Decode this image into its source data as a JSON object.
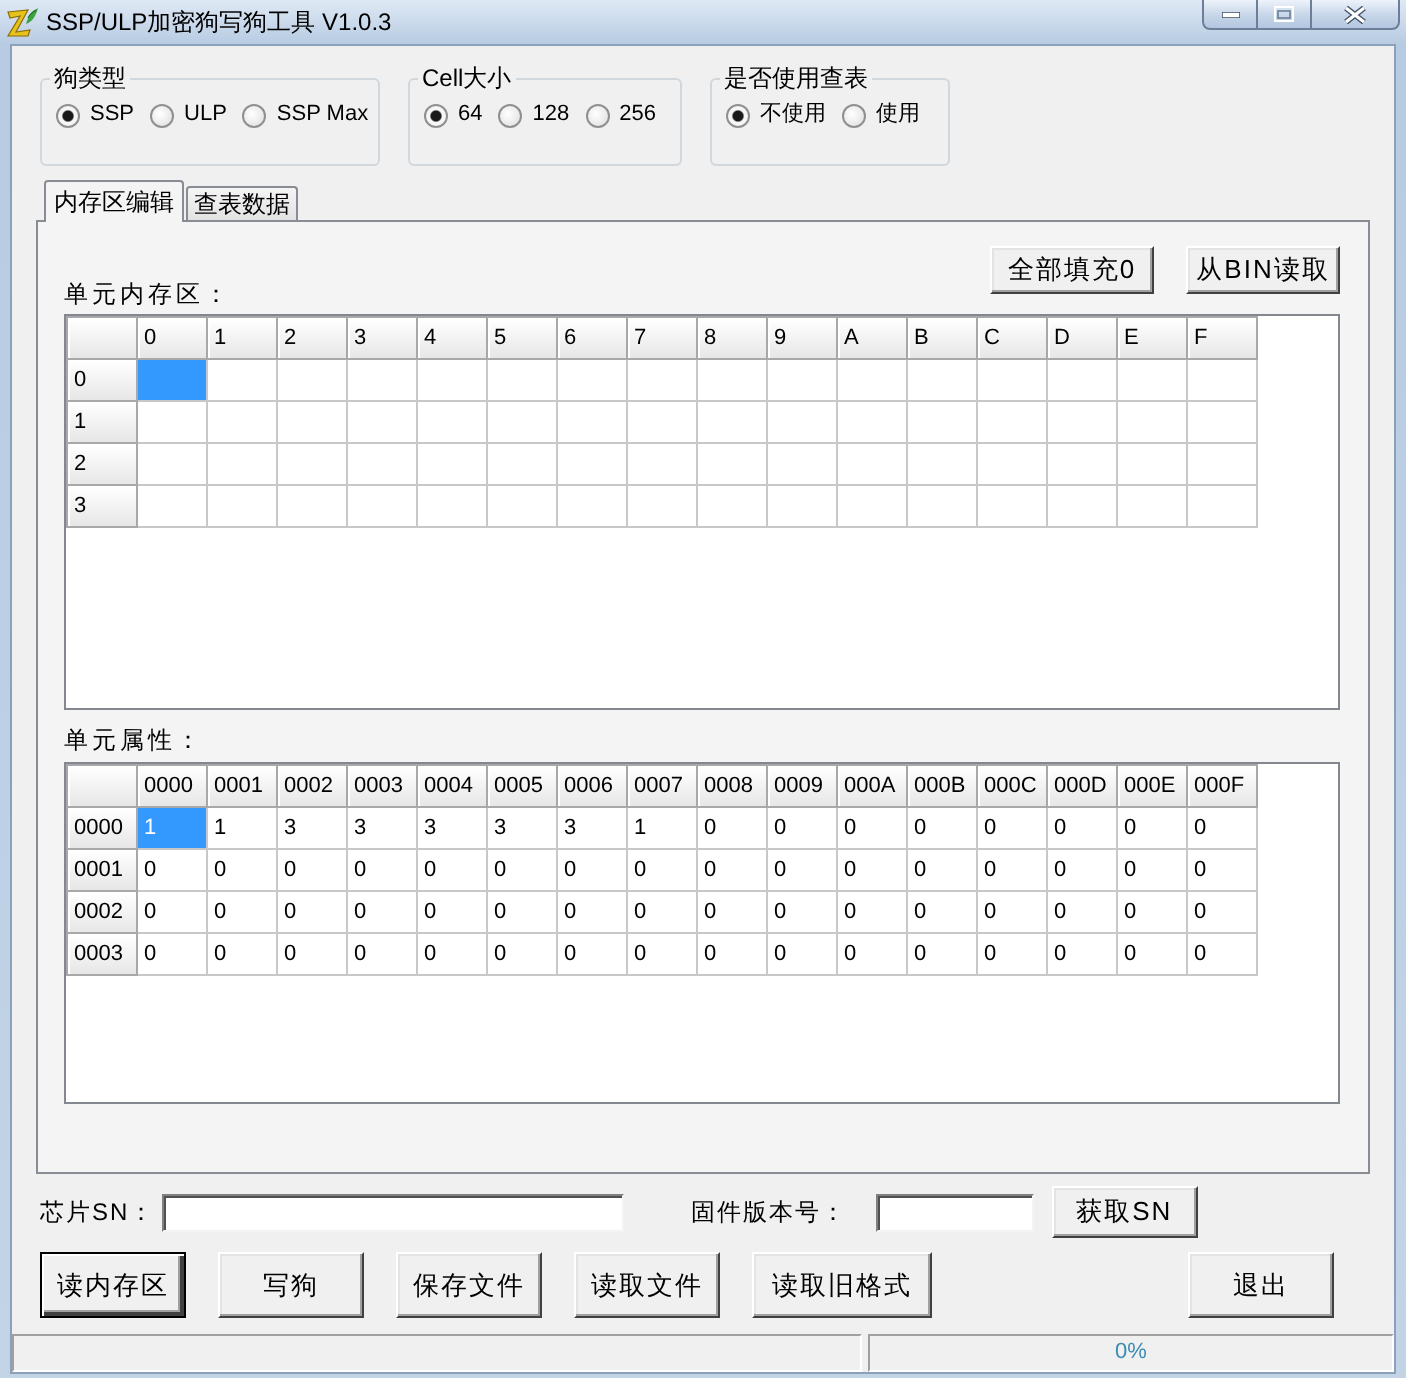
{
  "window": {
    "title": "SSP/ULP加密狗写狗工具 V1.0.3"
  },
  "option_groups": [
    {
      "label": "狗类型",
      "options": [
        {
          "label": "SSP",
          "selected": true
        },
        {
          "label": "ULP",
          "selected": false
        },
        {
          "label": "SSP Max",
          "selected": false
        }
      ]
    },
    {
      "label": "Cell大小",
      "options": [
        {
          "label": "64",
          "selected": true
        },
        {
          "label": "128",
          "selected": false
        },
        {
          "label": "256",
          "selected": false
        }
      ]
    },
    {
      "label": "是否使用查表",
      "options": [
        {
          "label": "不使用",
          "selected": true
        },
        {
          "label": "使用",
          "selected": false
        }
      ]
    }
  ],
  "tabs": [
    {
      "label": "内存区编辑",
      "selected": true
    },
    {
      "label": "查表数据",
      "selected": false
    }
  ],
  "memory_grid": {
    "label": "单元内存区：",
    "buttons": [
      "全部填充0",
      "从BIN读取"
    ],
    "columns": [
      "0",
      "1",
      "2",
      "3",
      "4",
      "5",
      "6",
      "7",
      "8",
      "9",
      "A",
      "B",
      "C",
      "D",
      "E",
      "F"
    ],
    "rows": [
      {
        "header": "0",
        "cells": [
          {
            "selected": true
          },
          {
            "selected": false
          },
          {
            "selected": false
          },
          {
            "selected": false
          },
          {
            "selected": false
          },
          {
            "selected": false
          },
          {
            "selected": false
          },
          {
            "selected": false
          },
          {
            "selected": false
          },
          {
            "selected": false
          },
          {
            "selected": false
          },
          {
            "selected": false
          },
          {
            "selected": false
          },
          {
            "selected": false
          },
          {
            "selected": false
          },
          {
            "selected": false
          }
        ]
      },
      {
        "header": "1",
        "cells": [
          {
            "selected": false
          },
          {
            "selected": false
          },
          {
            "selected": false
          },
          {
            "selected": false
          },
          {
            "selected": false
          },
          {
            "selected": false
          },
          {
            "selected": false
          },
          {
            "selected": false
          },
          {
            "selected": false
          },
          {
            "selected": false
          },
          {
            "selected": false
          },
          {
            "selected": false
          },
          {
            "selected": false
          },
          {
            "selected": false
          },
          {
            "selected": false
          },
          {
            "selected": false
          }
        ]
      },
      {
        "header": "2",
        "cells": [
          {
            "selected": false
          },
          {
            "selected": false
          },
          {
            "selected": false
          },
          {
            "selected": false
          },
          {
            "selected": false
          },
          {
            "selected": false
          },
          {
            "selected": false
          },
          {
            "selected": false
          },
          {
            "selected": false
          },
          {
            "selected": false
          },
          {
            "selected": false
          },
          {
            "selected": false
          },
          {
            "selected": false
          },
          {
            "selected": false
          },
          {
            "selected": false
          },
          {
            "selected": false
          }
        ]
      },
      {
        "header": "3",
        "cells": [
          {
            "selected": false
          },
          {
            "selected": false
          },
          {
            "selected": false
          },
          {
            "selected": false
          },
          {
            "selected": false
          },
          {
            "selected": false
          },
          {
            "selected": false
          },
          {
            "selected": false
          },
          {
            "selected": false
          },
          {
            "selected": false
          },
          {
            "selected": false
          },
          {
            "selected": false
          },
          {
            "selected": false
          },
          {
            "selected": false
          },
          {
            "selected": false
          },
          {
            "selected": false
          }
        ]
      }
    ]
  },
  "attribute_grid": {
    "label": "单元属性：",
    "columns": [
      "0000",
      "0001",
      "0002",
      "0003",
      "0004",
      "0005",
      "0006",
      "0007",
      "0008",
      "0009",
      "000A",
      "000B",
      "000C",
      "000D",
      "000E",
      "000F"
    ],
    "rows": [
      {
        "header": "0000",
        "cells": [
          {
            "text": "1",
            "selected": true
          },
          {
            "text": "1",
            "selected": false
          },
          {
            "text": "3",
            "selected": false
          },
          {
            "text": "3",
            "selected": false
          },
          {
            "text": "3",
            "selected": false
          },
          {
            "text": "3",
            "selected": false
          },
          {
            "text": "3",
            "selected": false
          },
          {
            "text": "1",
            "selected": false
          },
          {
            "text": "0",
            "selected": false
          },
          {
            "text": "0",
            "selected": false
          },
          {
            "text": "0",
            "selected": false
          },
          {
            "text": "0",
            "selected": false
          },
          {
            "text": "0",
            "selected": false
          },
          {
            "text": "0",
            "selected": false
          },
          {
            "text": "0",
            "selected": false
          },
          {
            "text": "0",
            "selected": false
          }
        ]
      },
      {
        "header": "0001",
        "cells": [
          {
            "text": "0",
            "selected": false
          },
          {
            "text": "0",
            "selected": false
          },
          {
            "text": "0",
            "selected": false
          },
          {
            "text": "0",
            "selected": false
          },
          {
            "text": "0",
            "selected": false
          },
          {
            "text": "0",
            "selected": false
          },
          {
            "text": "0",
            "selected": false
          },
          {
            "text": "0",
            "selected": false
          },
          {
            "text": "0",
            "selected": false
          },
          {
            "text": "0",
            "selected": false
          },
          {
            "text": "0",
            "selected": false
          },
          {
            "text": "0",
            "selected": false
          },
          {
            "text": "0",
            "selected": false
          },
          {
            "text": "0",
            "selected": false
          },
          {
            "text": "0",
            "selected": false
          },
          {
            "text": "0",
            "selected": false
          }
        ]
      },
      {
        "header": "0002",
        "cells": [
          {
            "text": "0",
            "selected": false
          },
          {
            "text": "0",
            "selected": false
          },
          {
            "text": "0",
            "selected": false
          },
          {
            "text": "0",
            "selected": false
          },
          {
            "text": "0",
            "selected": false
          },
          {
            "text": "0",
            "selected": false
          },
          {
            "text": "0",
            "selected": false
          },
          {
            "text": "0",
            "selected": false
          },
          {
            "text": "0",
            "selected": false
          },
          {
            "text": "0",
            "selected": false
          },
          {
            "text": "0",
            "selected": false
          },
          {
            "text": "0",
            "selected": false
          },
          {
            "text": "0",
            "selected": false
          },
          {
            "text": "0",
            "selected": false
          },
          {
            "text": "0",
            "selected": false
          },
          {
            "text": "0",
            "selected": false
          }
        ]
      },
      {
        "header": "0003",
        "cells": [
          {
            "text": "0",
            "selected": false
          },
          {
            "text": "0",
            "selected": false
          },
          {
            "text": "0",
            "selected": false
          },
          {
            "text": "0",
            "selected": false
          },
          {
            "text": "0",
            "selected": false
          },
          {
            "text": "0",
            "selected": false
          },
          {
            "text": "0",
            "selected": false
          },
          {
            "text": "0",
            "selected": false
          },
          {
            "text": "0",
            "selected": false
          },
          {
            "text": "0",
            "selected": false
          },
          {
            "text": "0",
            "selected": false
          },
          {
            "text": "0",
            "selected": false
          },
          {
            "text": "0",
            "selected": false
          },
          {
            "text": "0",
            "selected": false
          },
          {
            "text": "0",
            "selected": false
          },
          {
            "text": "0",
            "selected": false
          }
        ]
      }
    ]
  },
  "chip_sn": {
    "label": "芯片SN："
  },
  "firmware_version": {
    "label": "固件版本号："
  },
  "get_sn_button": "获取SN",
  "action_buttons": [
    {
      "label": "读内存区",
      "default": true
    },
    {
      "label": "写狗",
      "default": false
    },
    {
      "label": "保存文件",
      "default": false
    },
    {
      "label": "读取文件",
      "default": false
    },
    {
      "label": "读取旧格式",
      "default": false
    },
    {
      "label": "退出",
      "default": false
    }
  ],
  "status_bar": {
    "progress": {
      "level": 0,
      "reading": "0%"
    }
  }
}
